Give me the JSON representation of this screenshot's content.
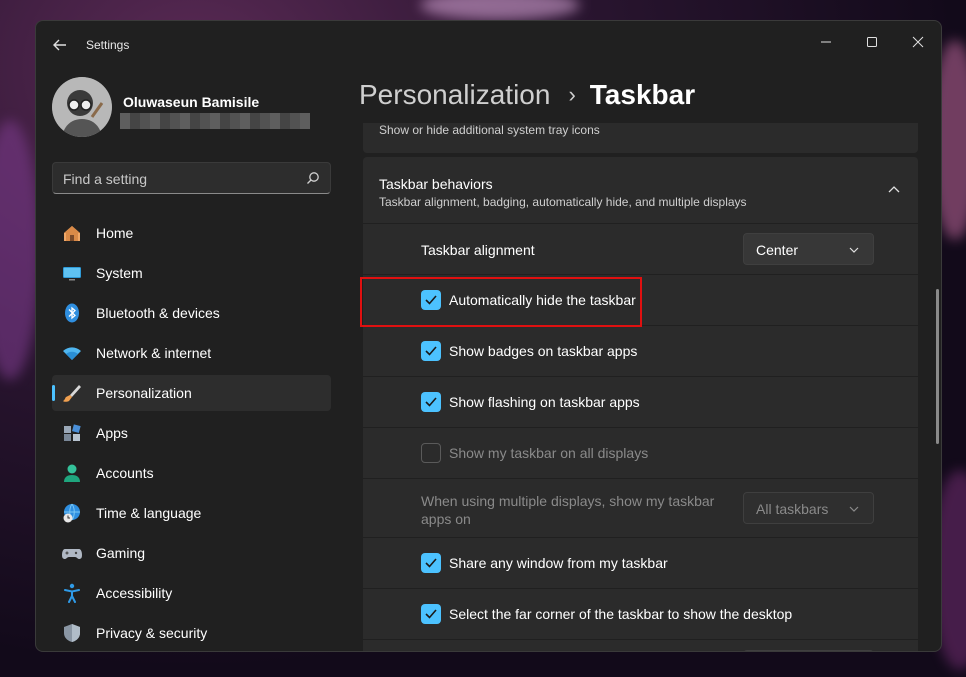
{
  "window": {
    "title": "Settings"
  },
  "profile": {
    "name": "Oluwaseun Bamisile"
  },
  "search": {
    "placeholder": "Find a setting"
  },
  "sidebar": {
    "items": [
      {
        "label": "Home",
        "icon": "home-icon"
      },
      {
        "label": "System",
        "icon": "monitor-icon"
      },
      {
        "label": "Bluetooth & devices",
        "icon": "bluetooth-icon"
      },
      {
        "label": "Network & internet",
        "icon": "wifi-icon"
      },
      {
        "label": "Personalization",
        "icon": "brush-icon",
        "active": true
      },
      {
        "label": "Apps",
        "icon": "apps-icon"
      },
      {
        "label": "Accounts",
        "icon": "person-icon"
      },
      {
        "label": "Time & language",
        "icon": "globe-clock-icon"
      },
      {
        "label": "Gaming",
        "icon": "gamepad-icon"
      },
      {
        "label": "Accessibility",
        "icon": "accessibility-icon"
      },
      {
        "label": "Privacy & security",
        "icon": "shield-icon"
      }
    ]
  },
  "breadcrumb": {
    "parent": "Personalization",
    "separator": "›",
    "current": "Taskbar"
  },
  "content": {
    "prev_card_text": "Show or hide additional system tray icons",
    "behaviors": {
      "title": "Taskbar behaviors",
      "subtitle": "Taskbar alignment, badging, automatically hide, and multiple displays",
      "alignment_label": "Taskbar alignment",
      "alignment_value": "Center",
      "checks": [
        {
          "label": "Automatically hide the taskbar",
          "checked": true,
          "enabled": true
        },
        {
          "label": "Show badges on taskbar apps",
          "checked": true,
          "enabled": true
        },
        {
          "label": "Show flashing on taskbar apps",
          "checked": true,
          "enabled": true
        },
        {
          "label": "Show my taskbar on all displays",
          "checked": false,
          "enabled": false
        }
      ],
      "multi_display_label_line1": "When using multiple displays, show my taskbar",
      "multi_display_label_line2": "apps on",
      "multi_display_value": "All taskbars",
      "checks2": [
        {
          "label": "Share any window from my taskbar",
          "checked": true,
          "enabled": true
        },
        {
          "label": "Select the far corner of the taskbar to show the desktop",
          "checked": true,
          "enabled": true
        }
      ]
    }
  },
  "colors": {
    "accent": "#4cc2ff",
    "highlight": "#e01010",
    "window_bg": "#202020",
    "card_bg": "#2b2b2b"
  }
}
